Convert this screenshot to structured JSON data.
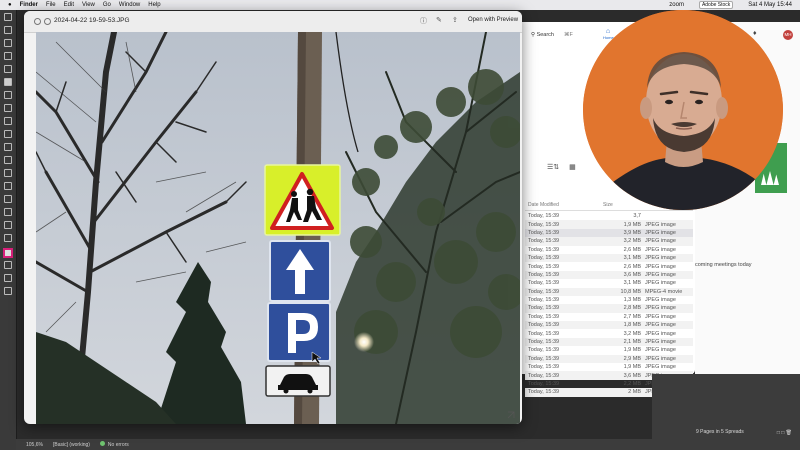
{
  "menubar": {
    "app": "Finder",
    "items": [
      "File",
      "Edit",
      "View",
      "Go",
      "Window",
      "Help"
    ],
    "zoom_label": "zoom",
    "datetime": "Sat 4 May  15:44",
    "search_placeholder": "Adobe Stock"
  },
  "preview": {
    "title": "2024-04-22 19-59-53.JPG",
    "open_button": "Open with Preview"
  },
  "finder": {
    "search_label": "Search",
    "search_shortcut": "⌘F",
    "home_label": "Home",
    "columns": {
      "date": "Date Modified",
      "size": "Size"
    },
    "rows": [
      {
        "date": "Today, 15:39",
        "size": "3,7",
        "kind": ""
      },
      {
        "date": "Today, 15:39",
        "size": "1,9 MB",
        "kind": "JPEG image"
      },
      {
        "date": "Today, 15:39",
        "size": "3,9 MB",
        "kind": "JPEG image"
      },
      {
        "date": "Today, 15:39",
        "size": "3,2 MB",
        "kind": "JPEG image"
      },
      {
        "date": "Today, 15:39",
        "size": "2,6 MB",
        "kind": "JPEG image"
      },
      {
        "date": "Today, 15:39",
        "size": "3,1 MB",
        "kind": "JPEG image"
      },
      {
        "date": "Today, 15:39",
        "size": "2,6 MB",
        "kind": "JPEG image"
      },
      {
        "date": "Today, 15:39",
        "size": "3,6 MB",
        "kind": "JPEG image"
      },
      {
        "date": "Today, 15:39",
        "size": "3,1 MB",
        "kind": "JPEG image"
      },
      {
        "date": "Today, 15:39",
        "size": "10,8 MB",
        "kind": "MPEG-4 movie"
      },
      {
        "date": "Today, 15:39",
        "size": "1,3 MB",
        "kind": "JPEG image"
      },
      {
        "date": "Today, 15:39",
        "size": "2,8 MB",
        "kind": "JPEG image"
      },
      {
        "date": "Today, 15:39",
        "size": "2,7 MB",
        "kind": "JPEG image"
      },
      {
        "date": "Today, 15:39",
        "size": "1,8 MB",
        "kind": "JPEG image"
      },
      {
        "date": "Today, 15:39",
        "size": "3,2 MB",
        "kind": "JPEG image"
      },
      {
        "date": "Today, 15:39",
        "size": "2,1 MB",
        "kind": "JPEG image"
      },
      {
        "date": "Today, 15:39",
        "size": "1,9 MB",
        "kind": "JPEG image"
      },
      {
        "date": "Today, 15:39",
        "size": "2,9 MB",
        "kind": "JPEG image"
      },
      {
        "date": "Today, 15:39",
        "size": "1,9 MB",
        "kind": "JPEG image"
      },
      {
        "date": "Today, 15:39",
        "size": "3,6 MB",
        "kind": "JPEG image"
      },
      {
        "date": "Today, 15:39",
        "size": "2,2 MB",
        "kind": "JPEG image"
      },
      {
        "date": "Today, 15:39",
        "size": "2 MB",
        "kind": "JPEG image"
      }
    ]
  },
  "panel": {
    "avatar_initials": "MH",
    "meetings_text": "coming meetings today"
  },
  "statusbar": {
    "zoom": "105,6%",
    "style": "[Basic] (working)",
    "errors": "No errors",
    "pages": "9 Pages in 5 Spreads"
  },
  "colors": {
    "webcam_bg": "#e1752e",
    "sign_yellow": "#d8ef2a",
    "sign_blue": "#2f4f9c",
    "accent_green": "#3f9e4f"
  },
  "icons": [
    "close-icon",
    "minimize-icon",
    "info-icon",
    "markup-icon",
    "share-icon",
    "home-icon",
    "bell-icon",
    "list-view-icon",
    "grid-view-icon"
  ]
}
